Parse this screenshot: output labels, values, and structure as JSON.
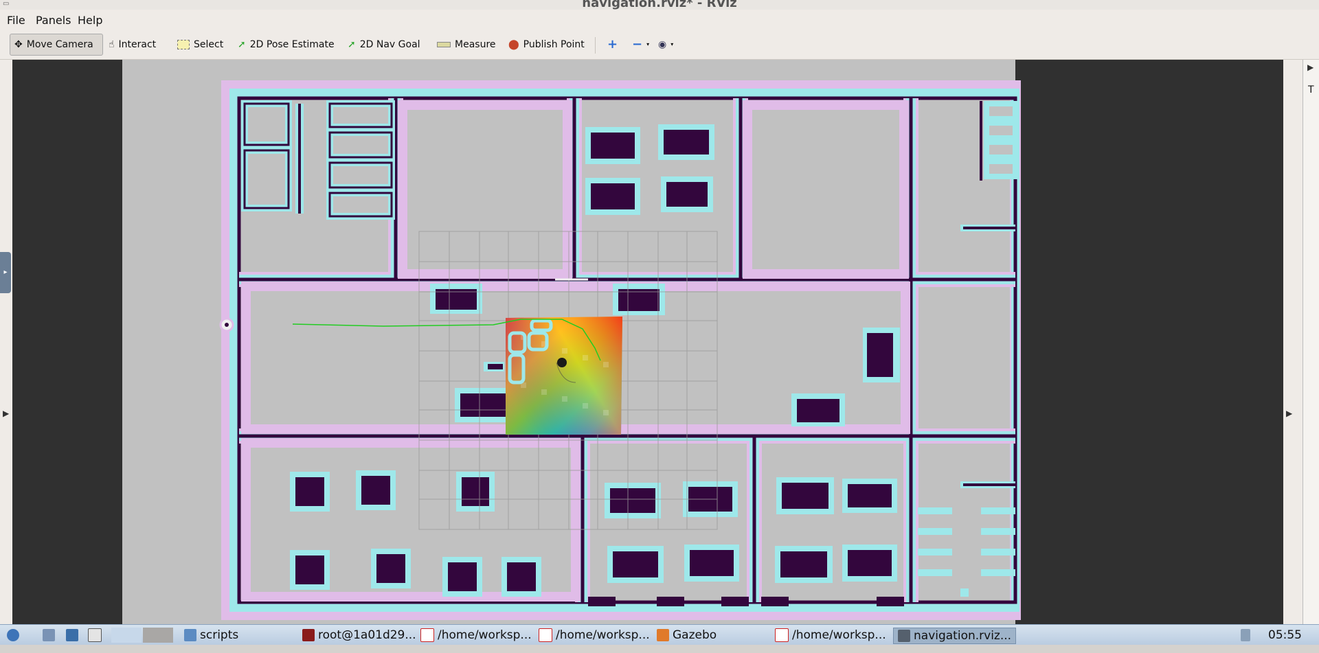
{
  "window": {
    "title": "navigation.rviz* - RViz"
  },
  "menu": {
    "file": "File",
    "panels": "Panels",
    "help": "Help"
  },
  "toolbar": {
    "move_camera": "Move Camera",
    "interact": "Interact",
    "select": "Select",
    "pose_estimate": "2D Pose Estimate",
    "nav_goal": "2D Nav Goal",
    "measure": "Measure",
    "publish_point": "Publish Point"
  },
  "right_panel": {
    "tab_letter": "T"
  },
  "taskbar": {
    "items": [
      {
        "label": "scripts",
        "icon": "folder-icon"
      },
      {
        "label": "root@1a01d29...",
        "icon": "terminal-icon"
      },
      {
        "label": "/home/worksp...",
        "icon": "text-editor-icon"
      },
      {
        "label": "/home/worksp...",
        "icon": "text-editor-icon"
      },
      {
        "label": "Gazebo",
        "icon": "gazebo-icon"
      },
      {
        "label": "/home/worksp...",
        "icon": "text-editor-icon"
      },
      {
        "label": "navigation.rviz...",
        "icon": "rviz-icon"
      }
    ],
    "clock": "05:55"
  },
  "colors": {
    "map_free": "#c1c1c1",
    "map_unknown": "#303030",
    "obstacle": "#33063d",
    "inflation_cyan": "#9ee8ea",
    "inflation_pink": "#e0bce8",
    "plan_path": "#22cc22"
  }
}
